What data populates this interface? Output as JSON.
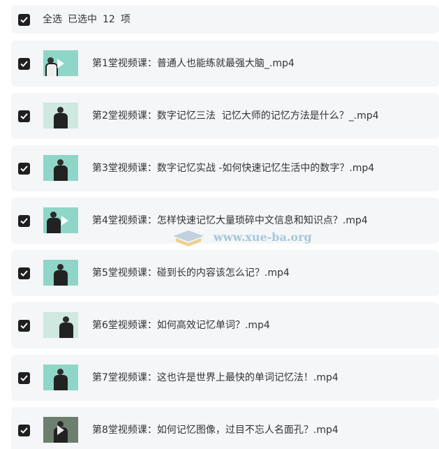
{
  "header": {
    "select_all": "全选",
    "selected_label": "已选中",
    "count": "12",
    "unit": "项"
  },
  "items": [
    {
      "title": "第1堂视频课：普通人也能练就最强大脑_.mp4",
      "checked": true
    },
    {
      "title": "第2堂视频课：数字记忆三法  记忆大师的记忆方法是什么？_.mp4",
      "checked": true
    },
    {
      "title": "第3堂视频课：数字记忆实战 -如何快速记忆生活中的数字？.mp4",
      "checked": true
    },
    {
      "title": "第4堂视频课：怎样快速记忆大量琐碎中文信息和知识点？.mp4",
      "checked": true
    },
    {
      "title": "第5堂视频课：碰到长的内容该怎么记？.mp4",
      "checked": true
    },
    {
      "title": "第6堂视频课：如何高效记忆单词？.mp4",
      "checked": true
    },
    {
      "title": "第7堂视频课：这也许是世界上最快的单词记忆法！.mp4",
      "checked": true
    },
    {
      "title": "第8堂视频课：如何记忆图像，过目不忘人名面孔？.mp4",
      "checked": true
    }
  ],
  "watermark": {
    "text": "www.xue-ba.org"
  },
  "colors": {
    "row_bg": "#f4f6f8",
    "checkbox": "#1f1f1f",
    "thumb": "#8fd6c8"
  }
}
